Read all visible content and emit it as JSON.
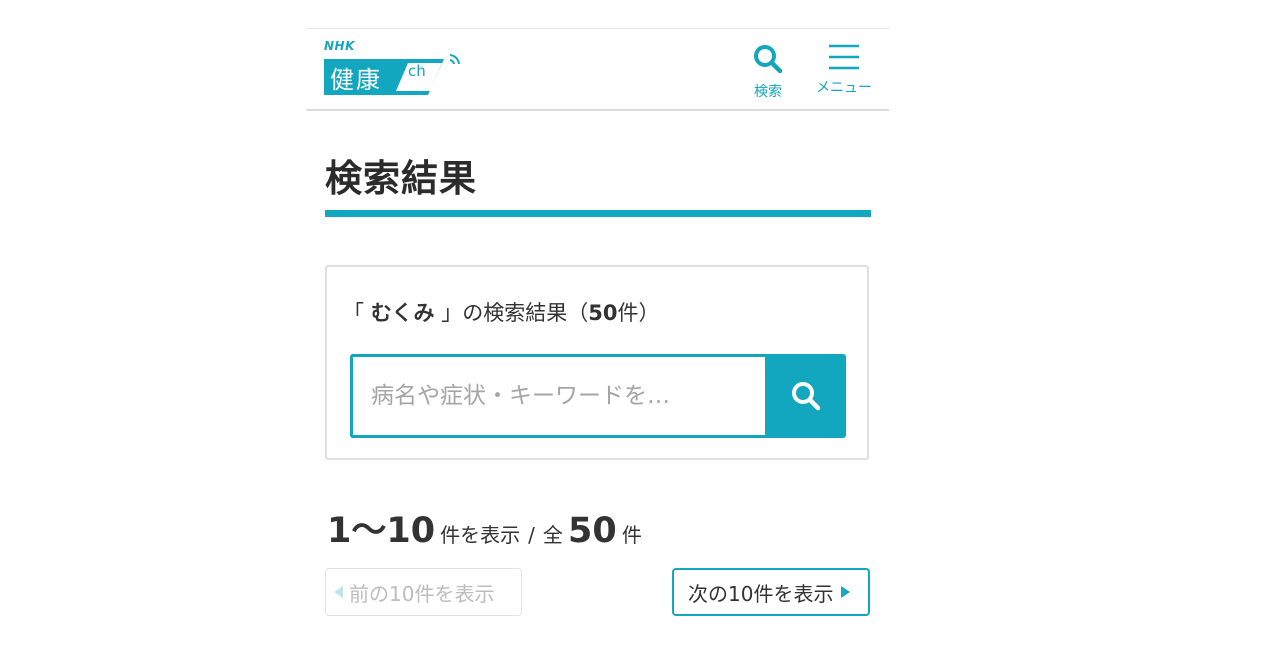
{
  "header": {
    "logo_brand": "NHK",
    "logo_title": "健康",
    "logo_suffix": "ch",
    "search_label": "検索",
    "menu_label": "メニュー"
  },
  "page_title": "検索結果",
  "search": {
    "open_bracket": "「",
    "keyword": "むくみ",
    "close_bracket": "」",
    "result_suffix": "の検索結果（",
    "total": "50",
    "count_unit": "件）",
    "placeholder": "病名や症状・キーワードを…"
  },
  "results": {
    "range": "1〜10",
    "range_unit": "件を表示",
    "separator": "/",
    "total_prefix": "全",
    "total": "50",
    "total_unit": "件"
  },
  "pagination": {
    "prev_label": "前の10件を表示",
    "next_label": "次の10件を表示"
  },
  "colors": {
    "accent": "#12a7be",
    "text": "#333333",
    "disabled": "#bdbdbd"
  }
}
